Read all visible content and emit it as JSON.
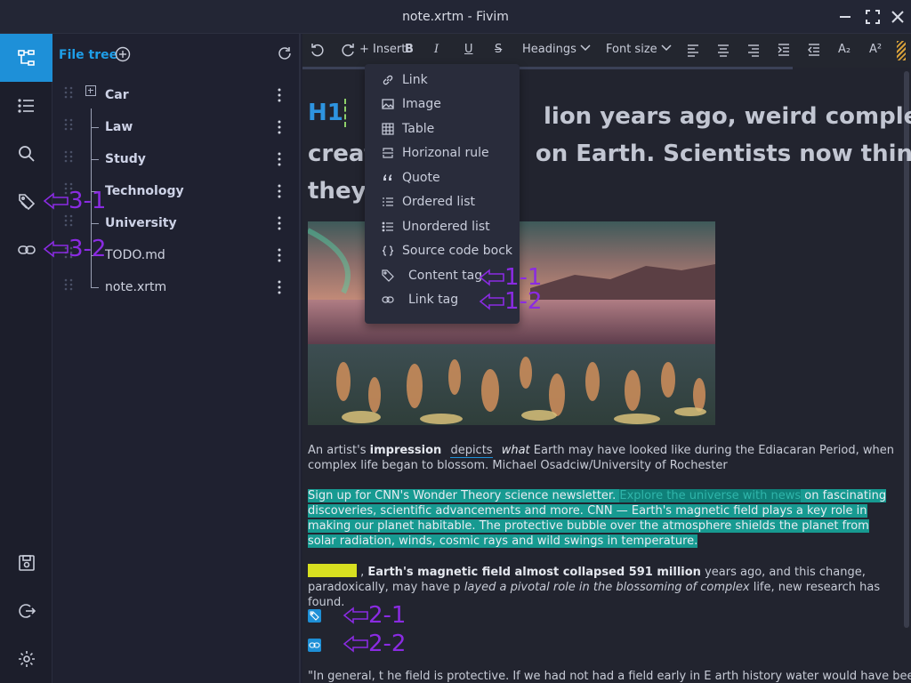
{
  "window": {
    "title": "note.xrtm - Fivim"
  },
  "activity_bar": {
    "items": [
      {
        "name": "file-tree-icon",
        "active": true
      },
      {
        "name": "outline-list-icon",
        "active": false
      },
      {
        "name": "search-icon",
        "active": false
      },
      {
        "name": "content-tag-icon",
        "active": false
      },
      {
        "name": "link-icon",
        "active": false
      }
    ],
    "bottom_items": [
      "save-icon",
      "logout-icon",
      "settings-icon"
    ]
  },
  "file_tree": {
    "label": "File tree",
    "items": [
      {
        "label": "Car",
        "type": "folder"
      },
      {
        "label": "Law",
        "type": "folder"
      },
      {
        "label": "Study",
        "type": "folder"
      },
      {
        "label": "Technology",
        "type": "folder"
      },
      {
        "label": "University",
        "type": "folder"
      },
      {
        "label": "TODO.md",
        "type": "file"
      },
      {
        "label": "note.xrtm",
        "type": "file"
      }
    ]
  },
  "toolbar": {
    "insert_label": "+ Insert",
    "bold_label": "B",
    "italic_label": "I",
    "underline_label": "U",
    "strike_label": "S",
    "headings_label": "Headings",
    "fontsize_label": "Font size",
    "subscript_label": "A₂",
    "superscript_label": "A²"
  },
  "insert_menu": {
    "items": [
      {
        "label": "Link",
        "icon": "link-icon"
      },
      {
        "label": "Image",
        "icon": "image-icon"
      },
      {
        "label": "Table",
        "icon": "table-icon"
      },
      {
        "label": "Horizonal rule",
        "icon": "horizontal-rule-icon"
      },
      {
        "label": "Quote",
        "icon": "quote-icon"
      },
      {
        "label": "Ordered list",
        "icon": "ordered-list-icon"
      },
      {
        "label": "Unordered list",
        "icon": "unordered-list-icon"
      },
      {
        "label": "Source code bock",
        "icon": "code-icon"
      },
      {
        "label": "Content tag",
        "icon": "tag-icon"
      },
      {
        "label": "Link tag",
        "icon": "link-tag-icon"
      }
    ]
  },
  "document": {
    "heading_marker": "H1",
    "heading_lines": [
      "lion years ago, weird complex",
      "on Earth. Scientists now think",
      "they l"
    ],
    "heading_prefixes": [
      "creat"
    ],
    "caption": {
      "prefix": "An artist's ",
      "bold": "impression",
      "link": "depicts",
      "italic": "what",
      "rest": " Earth may have looked like during the Ediacaran Period, when complex life began to blossom. Michael Osadciw/University of Rochester"
    },
    "para1": {
      "before": "Sign up for CNN's Wonder Theory science newsletter. ",
      "dim": "Explore the universe with news",
      "after": " on fascinating discoveries, scientific advancements and more. CNN  —  Earth's magnetic field plays a key role in making our planet habitable. The protective bubble over the atmosphere shields the planet from solar radiation, winds, cosmic rays and wild swings in temperature."
    },
    "para2": {
      "comma": " , ",
      "bold": "Earth's magnetic field almost collapsed 591 million",
      "mid": " years ago, and this change, paradoxically, may have p ",
      "italic": "layed a pivotal role in the blossoming of complex",
      "end": " life, new research has found."
    },
    "para3": "\"In general, t he field is protective. If we had not had a field early in E arth history water would have been"
  },
  "annotations": {
    "a11": "1-1",
    "a12": "1-2",
    "a21": "2-1",
    "a22": "2-2",
    "a31": "3-1",
    "a32": "3-2"
  },
  "colors": {
    "accent": "#1e90d8",
    "annotation": "#8a2be2",
    "highlight_teal": "#179a91",
    "highlight_yellow": "#d8e020"
  }
}
